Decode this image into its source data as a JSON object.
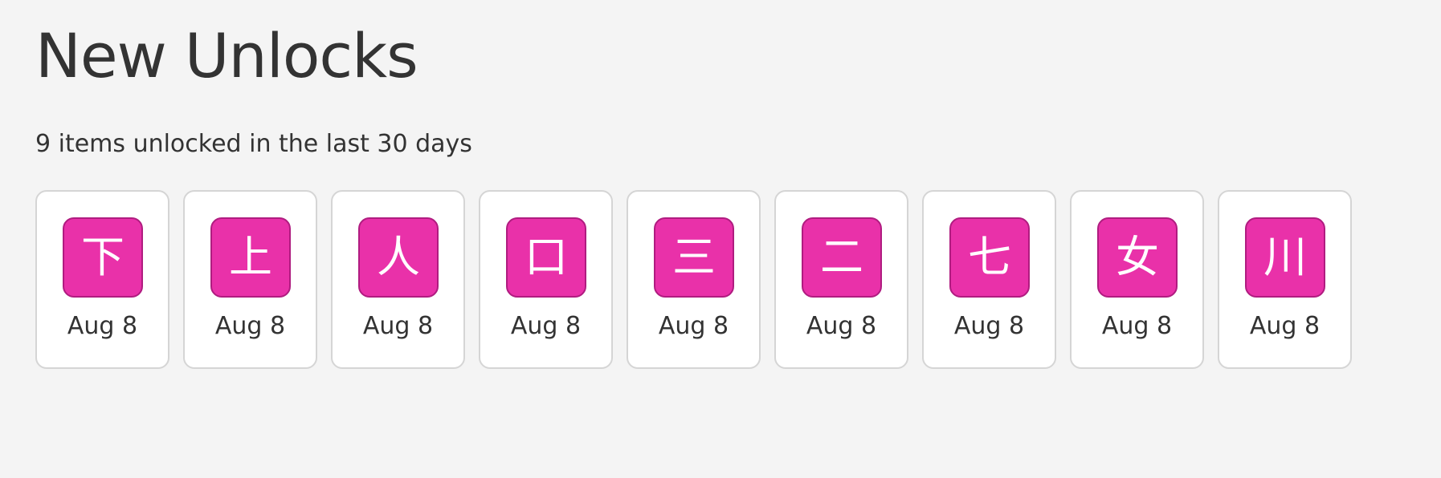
{
  "page": {
    "title": "New Unlocks",
    "summary": "9 items unlocked in the last 30 days"
  },
  "colors": {
    "background": "#f4f4f4",
    "tile": "#e931a9",
    "tile_border": "#b01c80",
    "card_border": "#d5d5d5",
    "text": "#333333"
  },
  "items": [
    {
      "character": "下",
      "date": "Aug 8"
    },
    {
      "character": "上",
      "date": "Aug 8"
    },
    {
      "character": "人",
      "date": "Aug 8"
    },
    {
      "character": "口",
      "date": "Aug 8"
    },
    {
      "character": "三",
      "date": "Aug 8"
    },
    {
      "character": "二",
      "date": "Aug 8"
    },
    {
      "character": "七",
      "date": "Aug 8"
    },
    {
      "character": "女",
      "date": "Aug 8"
    },
    {
      "character": "川",
      "date": "Aug 8"
    }
  ]
}
